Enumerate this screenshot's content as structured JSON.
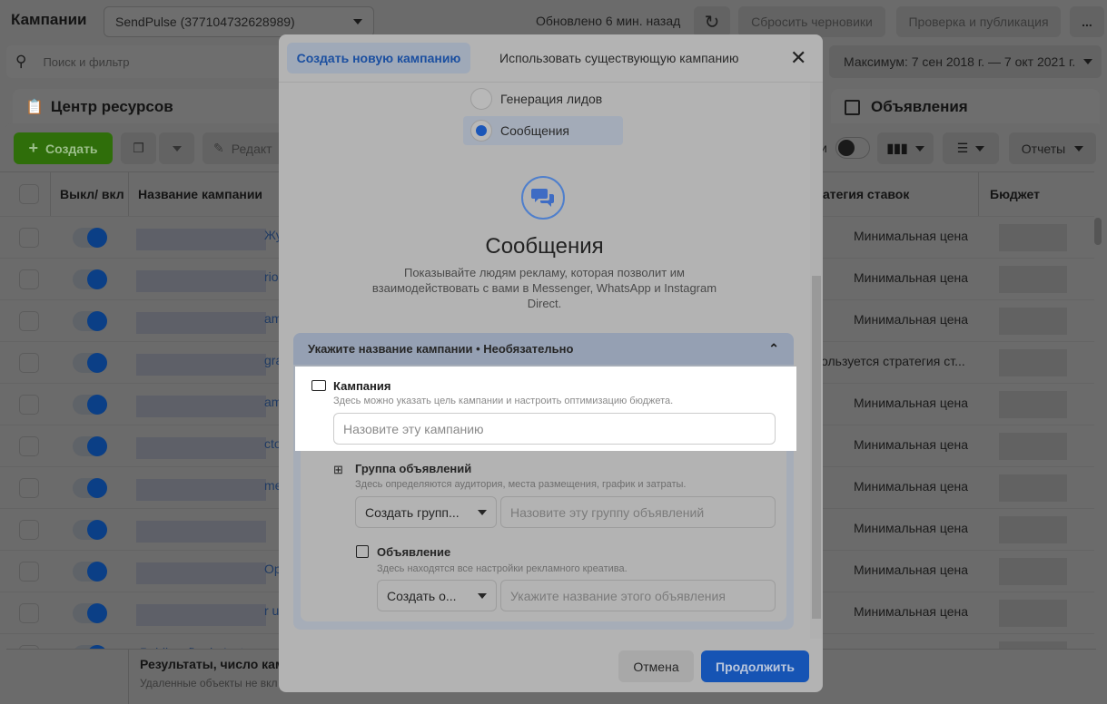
{
  "topbar": {
    "title": "Кампании",
    "account": "SendPulse (377104732628989)",
    "updated": "Обновлено 6 мин. назад",
    "discard": "Сбросить черновики",
    "review": "Проверка и публикация",
    "more": "..."
  },
  "search": {
    "placeholder": "Поиск и фильтр"
  },
  "date_range": "Максимум: 7 сен 2018 г. — 7 окт 2021 г.",
  "tabs": {
    "resources": "Центр ресурсов",
    "ads": "Объявления"
  },
  "toolbar": {
    "create": "Создать",
    "edit": "Редакт",
    "view_suffix": "и",
    "reports": "Отчеты"
  },
  "table": {
    "headers": {
      "toggle": "Выкл/ вкл",
      "name": "Название кампании",
      "strategy": "атегия ставок",
      "budget": "Бюджет"
    },
    "rows": [
      {
        "name": "Жу",
        "strategy": "Минимальная цена"
      },
      {
        "name": "rio",
        "strategy": "Минимальная цена"
      },
      {
        "name": "am",
        "strategy": "Минимальная цена"
      },
      {
        "name": "gra",
        "strategy": "ользуется стратегия ст..."
      },
      {
        "name": "am",
        "strategy": "Минимальная цена"
      },
      {
        "name": "cto",
        "strategy": "Минимальная цена"
      },
      {
        "name": "me",
        "strategy": "Минимальная цена"
      },
      {
        "name": "",
        "strategy": "Минимальная цена"
      },
      {
        "name": "Ope",
        "strategy": "Минимальная цена"
      },
      {
        "name": "r u",
        "strategy": "Минимальная цена"
      },
      {
        "name": "Publicação do Instagram",
        "strategy": "Минимальная цена"
      }
    ],
    "footer_title": "Результаты, число кам",
    "footer_note": "Удаленные объекты не вкл"
  },
  "modal": {
    "tab_new": "Создать новую кампанию",
    "tab_existing": "Использовать существующую кампанию",
    "options": [
      {
        "label": "Генерация лидов",
        "selected": false
      },
      {
        "label": "Сообщения",
        "selected": true
      }
    ],
    "objective_title": "Сообщения",
    "objective_desc": "Показывайте людям рекламу, которая позволит им взаимодействовать с вами в Messenger, WhatsApp и Instagram Direct.",
    "naming_header": "Укажите название кампании • Необязательно",
    "campaign": {
      "title": "Кампания",
      "desc": "Здесь можно указать цель кампании и настроить оптимизацию бюджета.",
      "placeholder": "Назовите эту кампанию"
    },
    "adset": {
      "title": "Группа объявлений",
      "desc": "Здесь определяются аудитория, места размещения, график и затраты.",
      "select": "Создать групп...",
      "placeholder": "Назовите эту группу объявлений"
    },
    "ad": {
      "title": "Объявление",
      "desc": "Здесь находятся все настройки рекламного креатива.",
      "select": "Создать о...",
      "placeholder": "Укажите название этого объявления"
    },
    "cancel": "Отмена",
    "continue": "Продолжить"
  },
  "colors": {
    "accent": "#1b62c9",
    "create_green": "#2f6e0a",
    "highlight": "#ffffff"
  }
}
